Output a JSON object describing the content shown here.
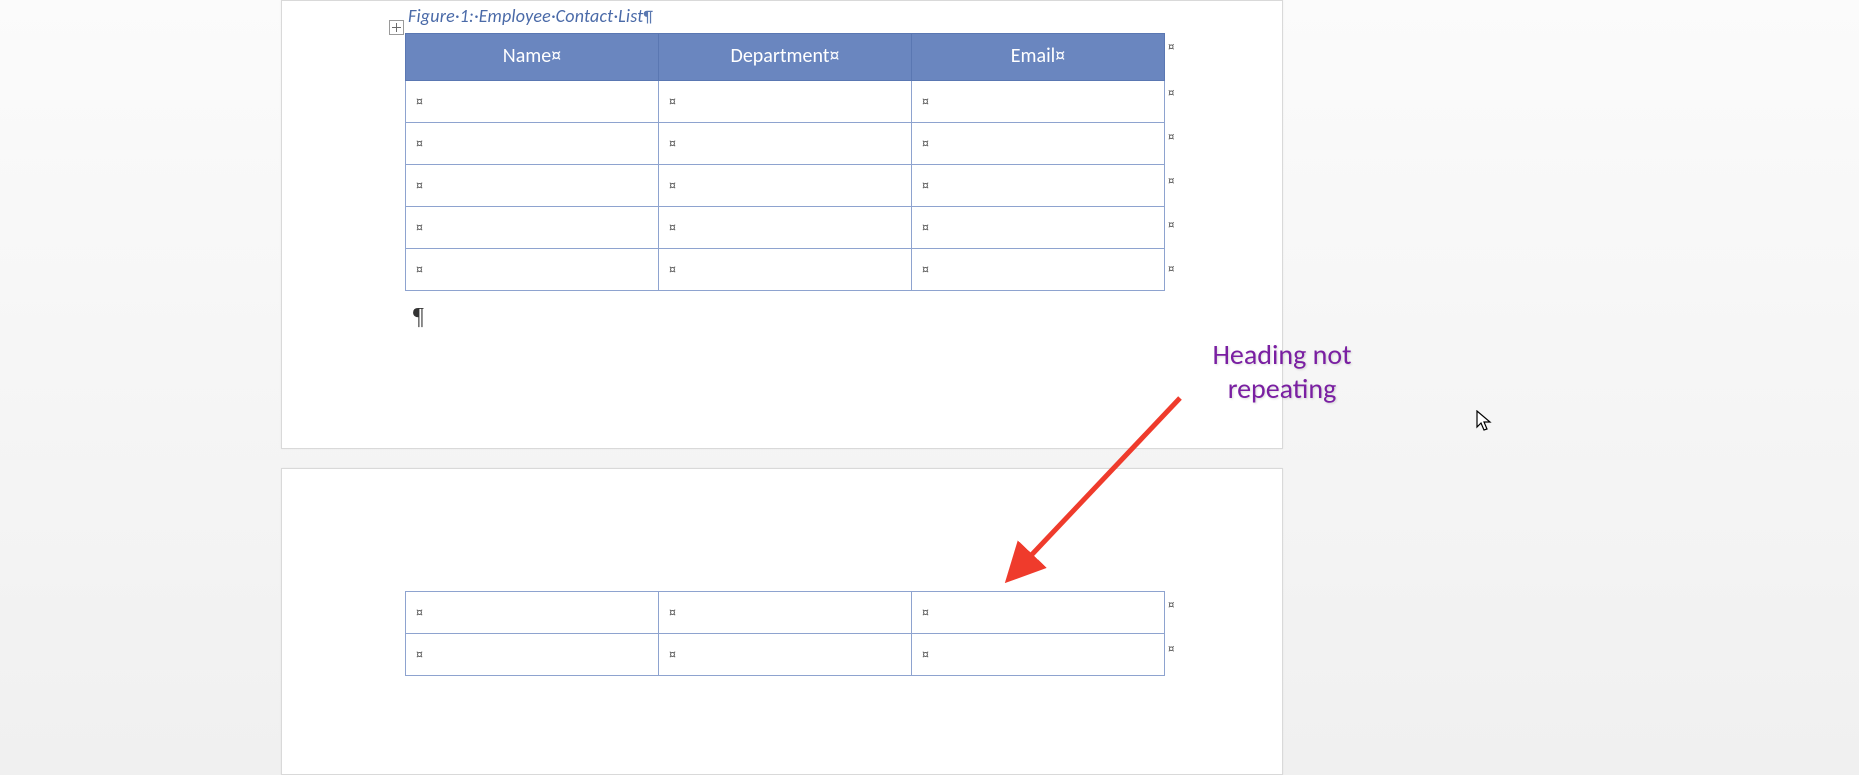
{
  "caption": {
    "text": "Figure·1:·Employee·Contact·List",
    "pilcrow": "¶"
  },
  "table": {
    "headers": [
      "Name¤",
      "Department¤",
      "Email¤"
    ],
    "cellMark": "¤",
    "rowEndMark": "¤",
    "rowsPage1": 5,
    "rowsPage2": 2
  },
  "paragraphMark": "¶",
  "annotation": {
    "line1": "Heading not",
    "line2": "repeating"
  },
  "colors": {
    "headerBg": "#6a86bf",
    "headerText": "#ffffff",
    "border": "#8ea3cf",
    "caption": "#4a6aa8",
    "annotation": "#7a1fa2",
    "arrow": "#ef3b2c"
  }
}
